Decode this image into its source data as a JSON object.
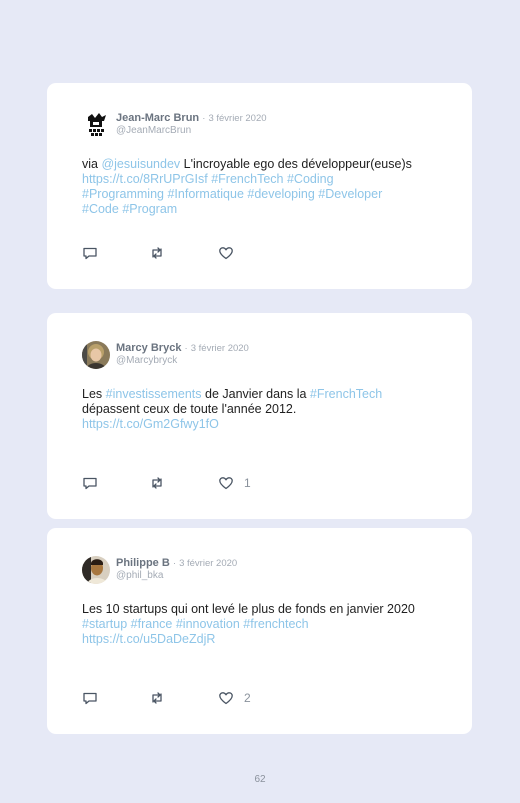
{
  "tweets": [
    {
      "name": "Jean-Marc Brun",
      "separator": "·",
      "date": "3 février 2020",
      "handle": "@JeanMarcBrun",
      "body": {
        "t0": "via ",
        "m1": "@jesuisundev",
        "t1": " L'incroyable ego des développeur(euse)s",
        "url": "https://t.co/8RrUPrGIsf",
        "h1": "#FrenchTech",
        "h2": "#Coding",
        "h3": "#Programming",
        "h4": "#Informatique",
        "h5": "#developing",
        "h6": "#Developer",
        "h7": "#Code",
        "h8": "#Program"
      },
      "likes": ""
    },
    {
      "name": "Marcy Bryck",
      "separator": "·",
      "date": "3 février 2020",
      "handle": "@Marcybryck",
      "body": {
        "t0": "Les ",
        "h1": "#investissements",
        "t1": " de Janvier dans la ",
        "h2": "#FrenchTech",
        "t2": "dépassent ceux de toute l'année 2012.",
        "url": "https://t.co/Gm2Gfwy1fO"
      },
      "likes": "1"
    },
    {
      "name": "Philippe B",
      "separator": "·",
      "date": "3 février 2020",
      "handle": "@phil_bka",
      "body": {
        "t0": "Les 10 startups qui ont levé le plus de fonds en janvier 2020",
        "h1": "#startup",
        "h2": "#france",
        "h3": "#innovation",
        "h4": "#frenchtech",
        "url": "https://t.co/u5DaDeZdjR"
      },
      "likes": "2"
    }
  ],
  "icons": [
    "reply-icon",
    "retweet-icon",
    "heart-icon"
  ],
  "colors": {
    "link": "#8ec5e8",
    "background": "#e6e9f6",
    "card": "#ffffff"
  },
  "page_number": "62"
}
